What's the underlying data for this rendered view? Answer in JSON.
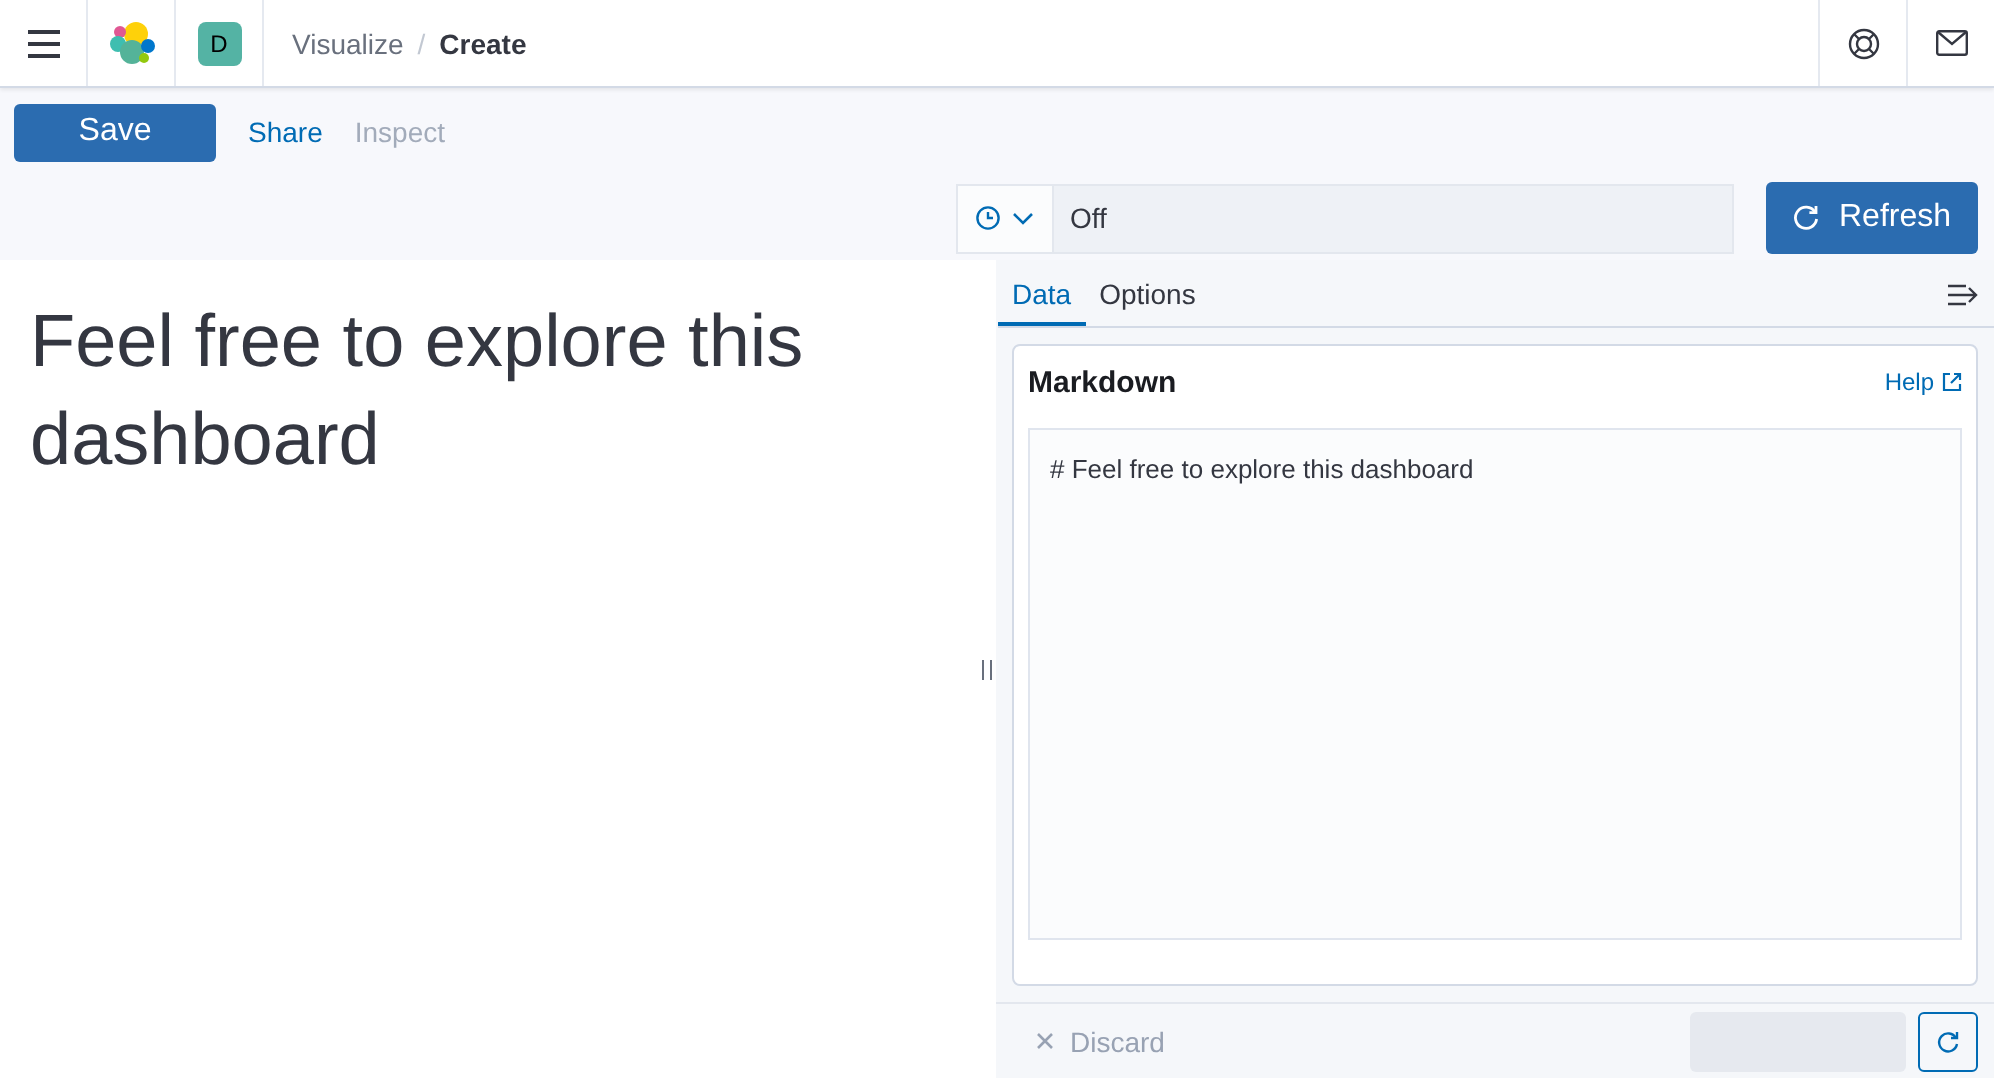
{
  "header": {
    "avatar": "D",
    "separator": "/",
    "breadcrumbs": [
      {
        "label": "Visualize",
        "current": false
      },
      {
        "label": "Create",
        "current": true
      }
    ]
  },
  "toolbar": {
    "save": "Save",
    "links": [
      {
        "label": "Share",
        "disabled": false
      },
      {
        "label": "Inspect",
        "disabled": true
      }
    ]
  },
  "refresh_picker": {
    "interval": "Off",
    "button": "Refresh"
  },
  "preview": {
    "text": "Feel free to explore this dashboard"
  },
  "editor": {
    "tabs": [
      {
        "label": "Data",
        "selected": true
      },
      {
        "label": "Options",
        "selected": false
      }
    ],
    "panel": {
      "title": "Markdown",
      "help": "Help",
      "content": "# Feel free to explore this dashboard"
    },
    "footer": {
      "discard": "Discard"
    }
  }
}
